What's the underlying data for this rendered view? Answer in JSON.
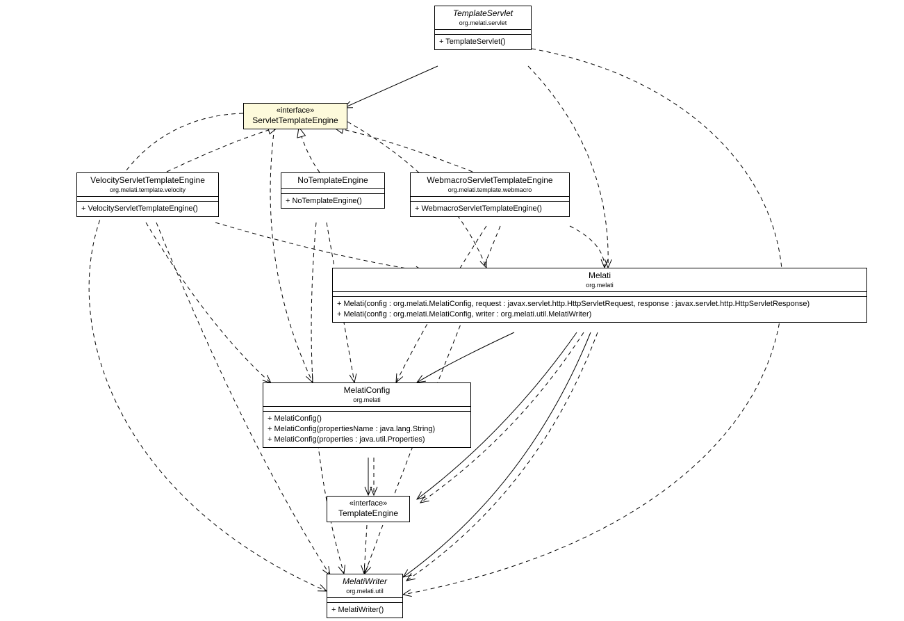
{
  "classes": {
    "templateServlet": {
      "name": "TemplateServlet",
      "abstract": true,
      "pkg": "org.melati.servlet",
      "ops": [
        "+ TemplateServlet()"
      ]
    },
    "servletTemplateEngine": {
      "stereotype": "«interface»",
      "name": "ServletTemplateEngine"
    },
    "velocityEngine": {
      "name": "VelocityServletTemplateEngine",
      "pkg": "org.melati.template.velocity",
      "ops": [
        "+ VelocityServletTemplateEngine()"
      ]
    },
    "noTemplateEngine": {
      "name": "NoTemplateEngine",
      "ops": [
        "+ NoTemplateEngine()"
      ]
    },
    "webmacroEngine": {
      "name": "WebmacroServletTemplateEngine",
      "pkg": "org.melati.template.webmacro",
      "ops": [
        "+ WebmacroServletTemplateEngine()"
      ]
    },
    "melati": {
      "name": "Melati",
      "pkg": "org.melati",
      "ops": [
        "+ Melati(config : org.melati.MelatiConfig, request : javax.servlet.http.HttpServletRequest, response : javax.servlet.http.HttpServletResponse)",
        "+ Melati(config : org.melati.MelatiConfig, writer : org.melati.util.MelatiWriter)"
      ]
    },
    "melatiConfig": {
      "name": "MelatiConfig",
      "pkg": "org.melati",
      "ops": [
        "+ MelatiConfig()",
        "+ MelatiConfig(propertiesName : java.lang.String)",
        "+ MelatiConfig(properties : java.util.Properties)"
      ]
    },
    "templateEngine": {
      "stereotype": "«interface»",
      "name": "TemplateEngine"
    },
    "melatiWriter": {
      "name": "MelatiWriter",
      "abstract": true,
      "pkg": "org.melati.util",
      "ops": [
        "+ MelatiWriter()"
      ]
    }
  }
}
